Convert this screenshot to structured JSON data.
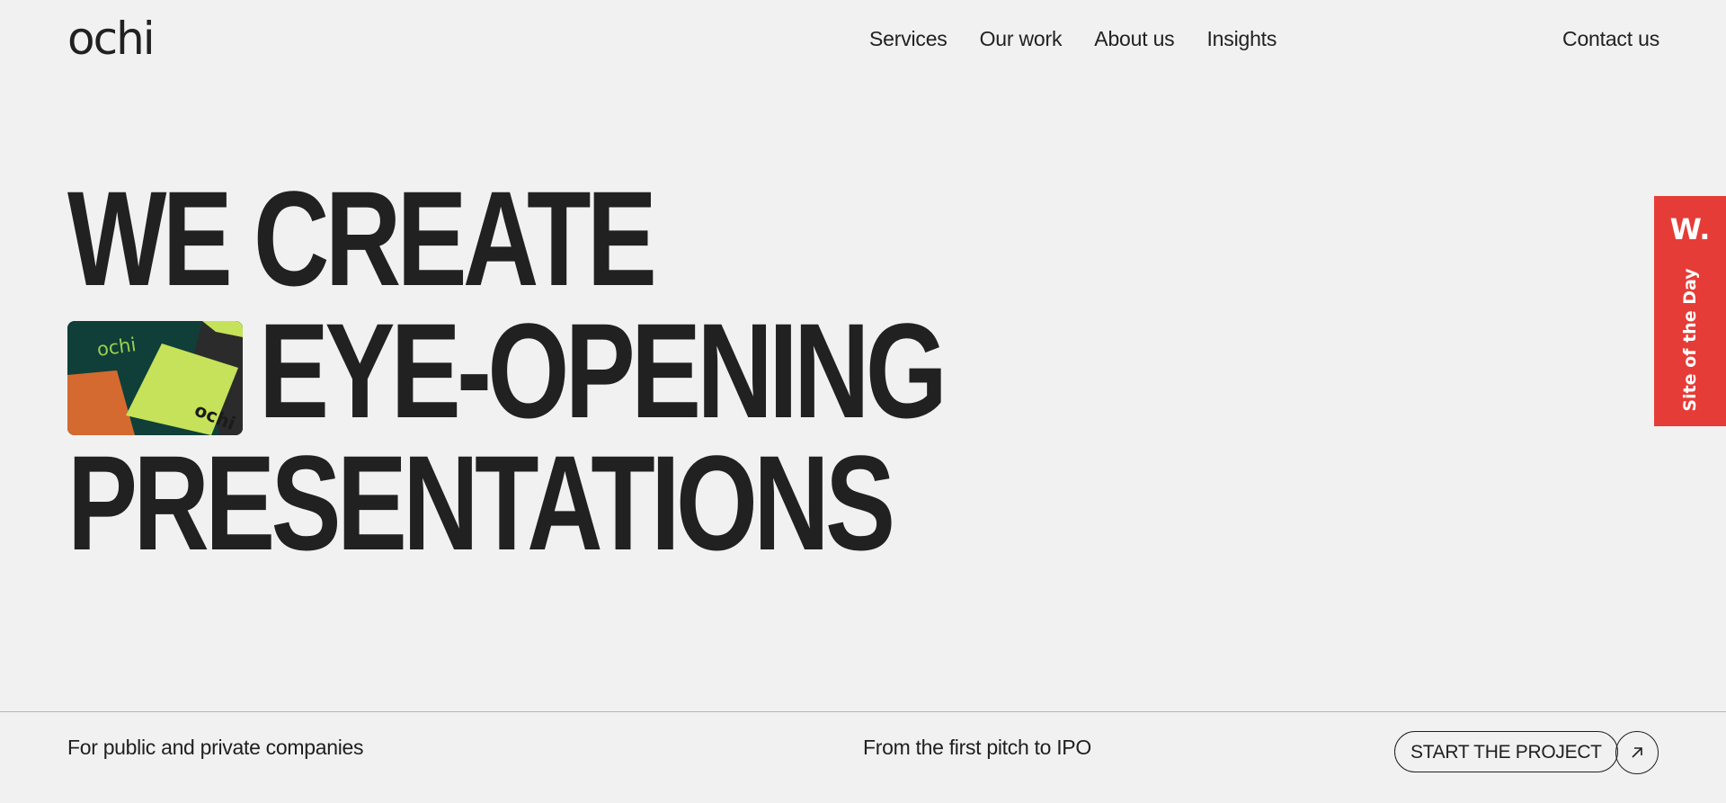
{
  "brand": {
    "logo_text": "ochi"
  },
  "nav": {
    "items": [
      {
        "label": "Services"
      },
      {
        "label": "Our work"
      },
      {
        "label": "About us"
      },
      {
        "label": "Insights"
      }
    ],
    "contact_label": "Contact us"
  },
  "hero": {
    "lines": [
      "WE CREATE",
      "EYE-OPENING",
      "PRESENTATIONS"
    ],
    "thumb_logo_text": "ochi"
  },
  "badge": {
    "mark": "W.",
    "label": "Site of the Day",
    "color": "#e63c37"
  },
  "footer": {
    "left_text": "For public and private companies",
    "middle_text": "From the first pitch to IPO",
    "cta_label": "START THE PROJECT",
    "cta_icon": "arrow-up-right-icon"
  },
  "colors": {
    "background": "#f1f1f1",
    "text": "#212121"
  }
}
